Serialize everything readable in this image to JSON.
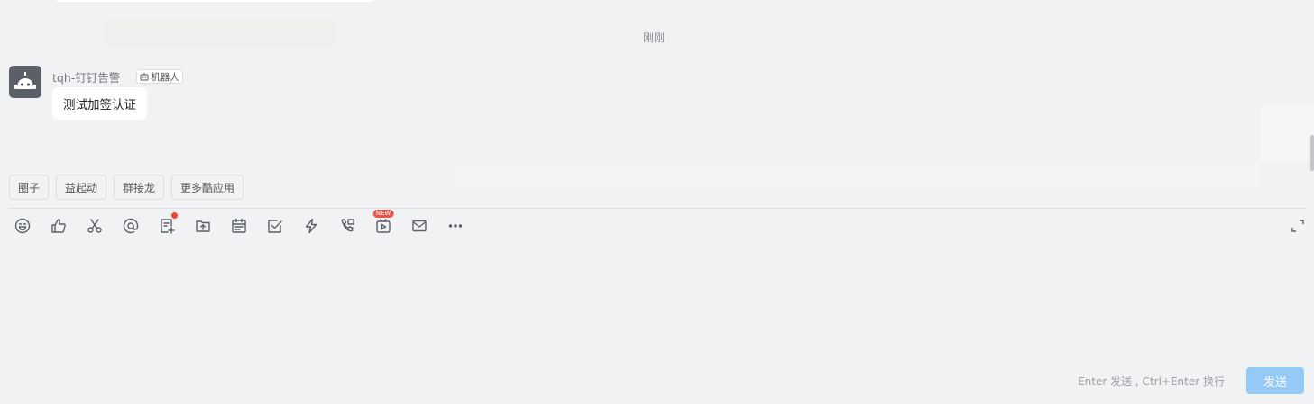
{
  "chat": {
    "timestamp": "刚刚",
    "message": {
      "sender": "tqh-钉钉告警",
      "badge": "机器人",
      "text": "测试加签认证",
      "avatar_icon": "robot-icon"
    }
  },
  "quick_apps": [
    "圈子",
    "益起动",
    "群接龙",
    "更多酷应用"
  ],
  "toolbar": {
    "icons": [
      "emoji-icon",
      "thumbs-up-icon",
      "scissors-icon",
      "at-icon",
      "doc-icon",
      "upload-file-icon",
      "calendar-icon",
      "todo-icon",
      "ding-icon",
      "phone-icon",
      "video-icon",
      "mail-icon",
      "more-icon"
    ],
    "new_badge": "NEW"
  },
  "composer": {
    "hint": "Enter 发送 , Ctrl+Enter 换行",
    "send_label": "发送"
  },
  "colors": {
    "background": "#f1f2f4",
    "send_button": "#95c9f6",
    "badge_red": "#e8554e",
    "avatar": "#5b6068"
  }
}
